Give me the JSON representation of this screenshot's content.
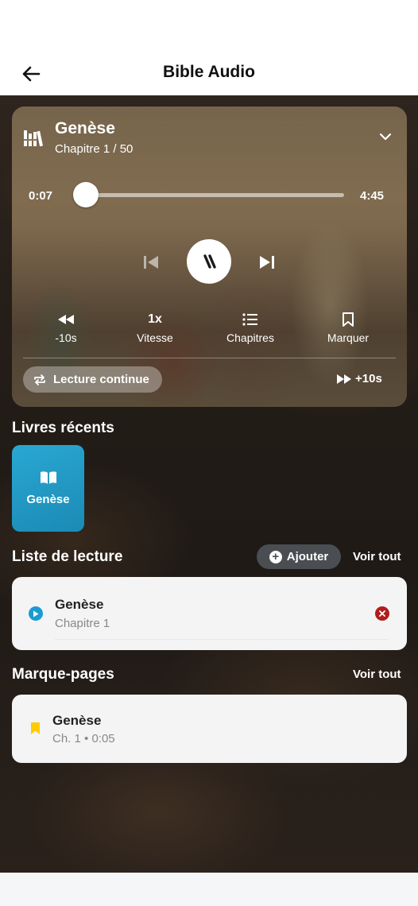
{
  "header": {
    "title": "Bible Audio"
  },
  "player": {
    "book": "Genèse",
    "chapter_line": "Chapitre 1 / 50",
    "current_time": "0:07",
    "total_time": "4:45",
    "progress_fraction": 0.025,
    "controls": {
      "rewind_label": "-10s",
      "speed_value": "1x",
      "speed_label": "Vitesse",
      "chapters_label": "Chapitres",
      "bookmark_label": "Marquer"
    },
    "continuous_label": "Lecture continue",
    "forward_label": "+10s"
  },
  "recent": {
    "title": "Livres récents",
    "items": [
      {
        "label": "Genèse",
        "color": "#1f98c6"
      }
    ]
  },
  "reading_list": {
    "title": "Liste de lecture",
    "add_label": "Ajouter",
    "see_all": "Voir tout",
    "items": [
      {
        "title": "Genèse",
        "subtitle": "Chapitre 1"
      }
    ]
  },
  "bookmarks": {
    "title": "Marque-pages",
    "see_all": "Voir tout",
    "items": [
      {
        "title": "Genèse",
        "subtitle": "Ch. 1 • 0:05"
      }
    ]
  },
  "colors": {
    "accent_blue": "#1b9bd1",
    "remove_red": "#b21c1c",
    "bookmark_yellow": "#ffcc00"
  },
  "icons": [
    "back-arrow-icon",
    "library-icon",
    "chevron-down-icon",
    "skip-previous-icon",
    "pause-icon",
    "skip-next-icon",
    "rewind-icon",
    "list-icon",
    "bookmark-outline-icon",
    "repeat-icon",
    "fast-forward-icon",
    "open-book-icon",
    "plus-circle-icon",
    "play-circle-icon",
    "close-circle-icon",
    "bookmark-filled-icon"
  ]
}
